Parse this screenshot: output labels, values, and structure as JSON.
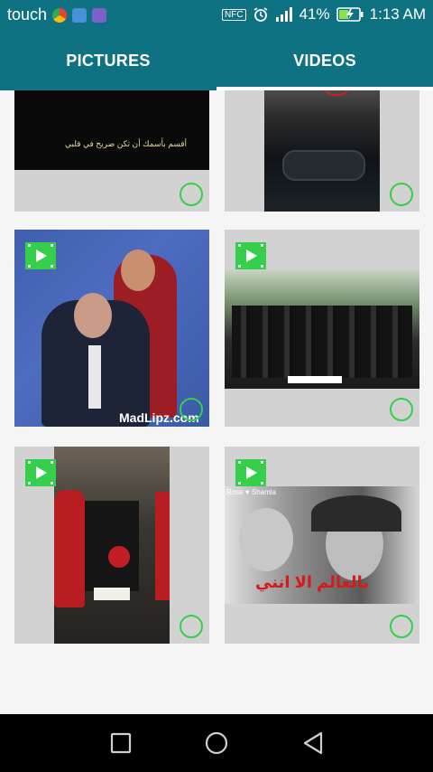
{
  "status_bar": {
    "carrier": "touch",
    "nfc": "NFC",
    "battery_percent": "41%",
    "time": "1:13 AM"
  },
  "tabs": [
    {
      "label": "PICTURES",
      "selected": false
    },
    {
      "label": "VIDEOS",
      "selected": true
    }
  ],
  "colors": {
    "primary": "#0f7283",
    "accent_green": "#35d04b",
    "card_bg": "#d2d2d2"
  },
  "cards": [
    {
      "type": "video",
      "badge_visible": false,
      "caption": "أقسم بأسمك أن تكن ضريح في قلبي"
    },
    {
      "type": "video",
      "badge_visible": false
    },
    {
      "type": "video",
      "badge_visible": true,
      "watermark": "MadLipz.com"
    },
    {
      "type": "video",
      "badge_visible": true
    },
    {
      "type": "video",
      "badge_visible": true
    },
    {
      "type": "video",
      "badge_visible": true,
      "tag": "Rose ♥ Shamla",
      "overlay_text": "بالعالم الا انني"
    }
  ],
  "nav": {
    "recents": "square-icon",
    "home": "circle-icon",
    "back": "triangle-back-icon"
  }
}
